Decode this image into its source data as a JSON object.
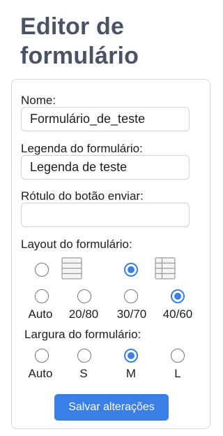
{
  "page": {
    "title_line1": "Editor de",
    "title_line2": "formulário"
  },
  "form": {
    "name_label": "Nome:",
    "name_value": "Formulário_de_teste",
    "caption_label": "Legenda do formulário:",
    "caption_value": "Legenda de teste",
    "submit_label_label": "Rótulo do botão enviar:",
    "submit_label_value": "",
    "layout_label": "Layout do formulário:",
    "layout_styles": [
      {
        "icon": "stacked-layout-icon",
        "selected": false
      },
      {
        "icon": "side-by-side-layout-icon",
        "selected": true
      }
    ],
    "label_width_options": [
      {
        "label": "Auto",
        "selected": false
      },
      {
        "label": "20/80",
        "selected": false
      },
      {
        "label": "30/70",
        "selected": false
      },
      {
        "label": "40/60",
        "selected": true
      }
    ],
    "width_label": "Largura do formulário:",
    "width_options": [
      {
        "label": "Auto",
        "selected": false
      },
      {
        "label": "S",
        "selected": false
      },
      {
        "label": "M",
        "selected": true
      },
      {
        "label": "L",
        "selected": false
      }
    ],
    "save_button": "Salvar alterações"
  },
  "colors": {
    "accent": "#3a7ee8",
    "title": "#4a5366",
    "border": "#d4d6da"
  }
}
